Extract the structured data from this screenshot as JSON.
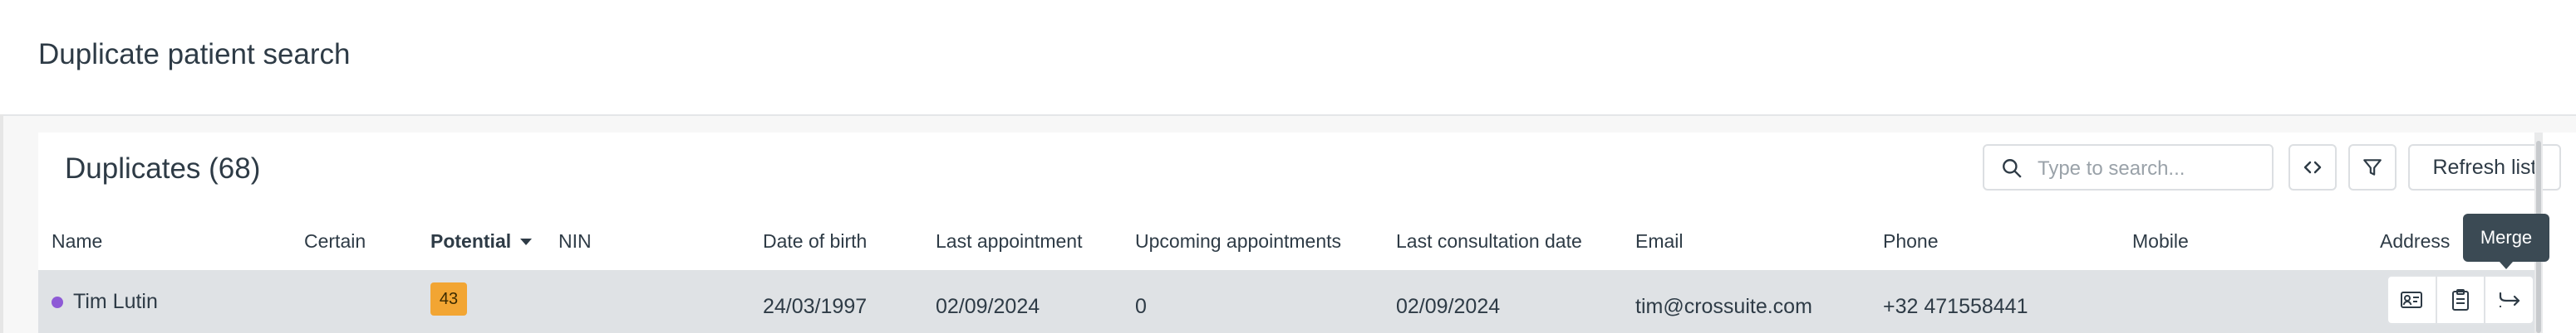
{
  "header": {
    "title": "Duplicate patient search"
  },
  "duplicates": {
    "title": "Duplicates (68)",
    "search": {
      "placeholder": "Type to search...",
      "value": ""
    },
    "toolbar": {
      "refresh_label": "Refresh list"
    },
    "columns": {
      "name": "Name",
      "certain": "Certain",
      "potential": "Potential",
      "nin": "NIN",
      "dob": "Date of birth",
      "last_appointment": "Last appointment",
      "upcoming_appointments": "Upcoming appointments",
      "last_consultation_date": "Last consultation date",
      "email": "Email",
      "phone": "Phone",
      "mobile": "Mobile",
      "address": "Address"
    },
    "rows": [
      {
        "name": "Tim Lutin",
        "certain": "",
        "potential": "43",
        "nin": "",
        "dob": "24/03/1997",
        "last_appointment": "02/09/2024",
        "upcoming_appointments": "0",
        "last_consultation_date": "02/09/2024",
        "email": "tim@crossuite.com",
        "phone": "+32 471558441",
        "mobile": "",
        "address": ""
      }
    ]
  },
  "tooltip": {
    "text": "Merge"
  },
  "icons": {
    "search": "search-icon",
    "code": "code-icon",
    "filter": "filter-icon",
    "patient_card": "id-card-icon",
    "clipboard": "clipboard-icon",
    "merge": "merge-icon"
  },
  "colors": {
    "accent_badge": "#f2a533",
    "status_dot": "#8e5ad6",
    "row_highlight": "#dfe2e5",
    "tooltip_bg": "#3b4a54"
  }
}
